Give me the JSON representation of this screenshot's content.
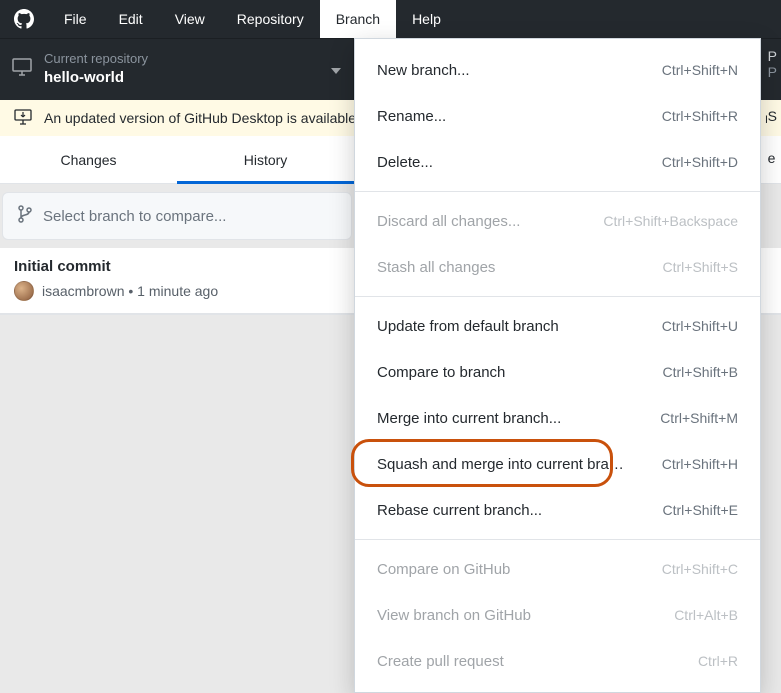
{
  "menubar": {
    "items": [
      "File",
      "Edit",
      "View",
      "Repository",
      "Branch",
      "Help"
    ],
    "active_index": 4
  },
  "toolbar": {
    "repo_label": "Current repository",
    "repo_name": "hello-world"
  },
  "right_edge": {
    "line1a": "P",
    "line1b": "P",
    "line2": "S",
    "line3": "e"
  },
  "update_bar": {
    "text": "An updated version of GitHub Desktop is available and will be installed at the next launch. See what's new or restart now."
  },
  "tabs": {
    "items": [
      "Changes",
      "History"
    ],
    "active_index": 1
  },
  "branch_select": {
    "placeholder": "Select branch to compare..."
  },
  "commits": [
    {
      "title": "Initial commit",
      "author": "isaacmbrown",
      "time": "1 minute ago"
    }
  ],
  "dropdown": {
    "groups": [
      [
        {
          "label": "New branch...",
          "shortcut": "Ctrl+Shift+N",
          "enabled": true
        },
        {
          "label": "Rename...",
          "shortcut": "Ctrl+Shift+R",
          "enabled": true
        },
        {
          "label": "Delete...",
          "shortcut": "Ctrl+Shift+D",
          "enabled": true
        }
      ],
      [
        {
          "label": "Discard all changes...",
          "shortcut": "Ctrl+Shift+Backspace",
          "enabled": false
        },
        {
          "label": "Stash all changes",
          "shortcut": "Ctrl+Shift+S",
          "enabled": false
        }
      ],
      [
        {
          "label": "Update from default branch",
          "shortcut": "Ctrl+Shift+U",
          "enabled": true
        },
        {
          "label": "Compare to branch",
          "shortcut": "Ctrl+Shift+B",
          "enabled": true
        },
        {
          "label": "Merge into current branch...",
          "shortcut": "Ctrl+Shift+M",
          "enabled": true
        },
        {
          "label": "Squash and merge into current branch...",
          "shortcut": "Ctrl+Shift+H",
          "enabled": true,
          "highlighted": true
        },
        {
          "label": "Rebase current branch...",
          "shortcut": "Ctrl+Shift+E",
          "enabled": true
        }
      ],
      [
        {
          "label": "Compare on GitHub",
          "shortcut": "Ctrl+Shift+C",
          "enabled": false
        },
        {
          "label": "View branch on GitHub",
          "shortcut": "Ctrl+Alt+B",
          "enabled": false
        },
        {
          "label": "Create pull request",
          "shortcut": "Ctrl+R",
          "enabled": false
        }
      ]
    ]
  }
}
